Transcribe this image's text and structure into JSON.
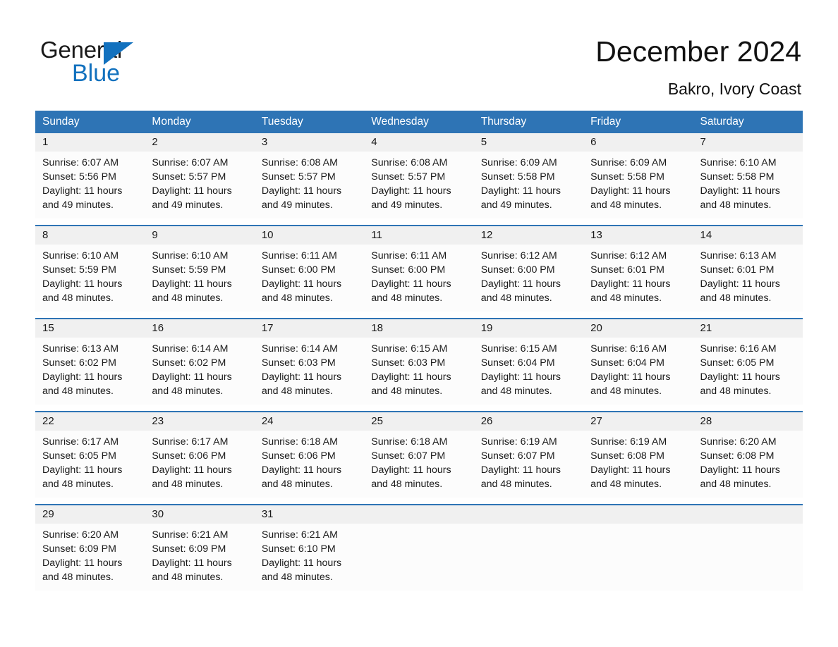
{
  "logo": {
    "word_one": "General",
    "word_two": "Blue",
    "triangle_color": "#1271BE",
    "text_color": "#1a1a1a"
  },
  "header": {
    "title": "December 2024",
    "location": "Bakro, Ivory Coast"
  },
  "theme": {
    "header_blue": "#2E74B5",
    "daynum_band": "#F0F0F0",
    "cell_background": "#FCFCFC",
    "text": "#1a1a1a"
  },
  "weekdays": [
    "Sunday",
    "Monday",
    "Tuesday",
    "Wednesday",
    "Thursday",
    "Friday",
    "Saturday"
  ],
  "weeks": [
    {
      "days": [
        {
          "num": "1",
          "sunrise": "Sunrise: 6:07 AM",
          "sunset": "Sunset: 5:56 PM",
          "daylight": "Daylight: 11 hours and 49 minutes."
        },
        {
          "num": "2",
          "sunrise": "Sunrise: 6:07 AM",
          "sunset": "Sunset: 5:57 PM",
          "daylight": "Daylight: 11 hours and 49 minutes."
        },
        {
          "num": "3",
          "sunrise": "Sunrise: 6:08 AM",
          "sunset": "Sunset: 5:57 PM",
          "daylight": "Daylight: 11 hours and 49 minutes."
        },
        {
          "num": "4",
          "sunrise": "Sunrise: 6:08 AM",
          "sunset": "Sunset: 5:57 PM",
          "daylight": "Daylight: 11 hours and 49 minutes."
        },
        {
          "num": "5",
          "sunrise": "Sunrise: 6:09 AM",
          "sunset": "Sunset: 5:58 PM",
          "daylight": "Daylight: 11 hours and 49 minutes."
        },
        {
          "num": "6",
          "sunrise": "Sunrise: 6:09 AM",
          "sunset": "Sunset: 5:58 PM",
          "daylight": "Daylight: 11 hours and 48 minutes."
        },
        {
          "num": "7",
          "sunrise": "Sunrise: 6:10 AM",
          "sunset": "Sunset: 5:58 PM",
          "daylight": "Daylight: 11 hours and 48 minutes."
        }
      ]
    },
    {
      "days": [
        {
          "num": "8",
          "sunrise": "Sunrise: 6:10 AM",
          "sunset": "Sunset: 5:59 PM",
          "daylight": "Daylight: 11 hours and 48 minutes."
        },
        {
          "num": "9",
          "sunrise": "Sunrise: 6:10 AM",
          "sunset": "Sunset: 5:59 PM",
          "daylight": "Daylight: 11 hours and 48 minutes."
        },
        {
          "num": "10",
          "sunrise": "Sunrise: 6:11 AM",
          "sunset": "Sunset: 6:00 PM",
          "daylight": "Daylight: 11 hours and 48 minutes."
        },
        {
          "num": "11",
          "sunrise": "Sunrise: 6:11 AM",
          "sunset": "Sunset: 6:00 PM",
          "daylight": "Daylight: 11 hours and 48 minutes."
        },
        {
          "num": "12",
          "sunrise": "Sunrise: 6:12 AM",
          "sunset": "Sunset: 6:00 PM",
          "daylight": "Daylight: 11 hours and 48 minutes."
        },
        {
          "num": "13",
          "sunrise": "Sunrise: 6:12 AM",
          "sunset": "Sunset: 6:01 PM",
          "daylight": "Daylight: 11 hours and 48 minutes."
        },
        {
          "num": "14",
          "sunrise": "Sunrise: 6:13 AM",
          "sunset": "Sunset: 6:01 PM",
          "daylight": "Daylight: 11 hours and 48 minutes."
        }
      ]
    },
    {
      "days": [
        {
          "num": "15",
          "sunrise": "Sunrise: 6:13 AM",
          "sunset": "Sunset: 6:02 PM",
          "daylight": "Daylight: 11 hours and 48 minutes."
        },
        {
          "num": "16",
          "sunrise": "Sunrise: 6:14 AM",
          "sunset": "Sunset: 6:02 PM",
          "daylight": "Daylight: 11 hours and 48 minutes."
        },
        {
          "num": "17",
          "sunrise": "Sunrise: 6:14 AM",
          "sunset": "Sunset: 6:03 PM",
          "daylight": "Daylight: 11 hours and 48 minutes."
        },
        {
          "num": "18",
          "sunrise": "Sunrise: 6:15 AM",
          "sunset": "Sunset: 6:03 PM",
          "daylight": "Daylight: 11 hours and 48 minutes."
        },
        {
          "num": "19",
          "sunrise": "Sunrise: 6:15 AM",
          "sunset": "Sunset: 6:04 PM",
          "daylight": "Daylight: 11 hours and 48 minutes."
        },
        {
          "num": "20",
          "sunrise": "Sunrise: 6:16 AM",
          "sunset": "Sunset: 6:04 PM",
          "daylight": "Daylight: 11 hours and 48 minutes."
        },
        {
          "num": "21",
          "sunrise": "Sunrise: 6:16 AM",
          "sunset": "Sunset: 6:05 PM",
          "daylight": "Daylight: 11 hours and 48 minutes."
        }
      ]
    },
    {
      "days": [
        {
          "num": "22",
          "sunrise": "Sunrise: 6:17 AM",
          "sunset": "Sunset: 6:05 PM",
          "daylight": "Daylight: 11 hours and 48 minutes."
        },
        {
          "num": "23",
          "sunrise": "Sunrise: 6:17 AM",
          "sunset": "Sunset: 6:06 PM",
          "daylight": "Daylight: 11 hours and 48 minutes."
        },
        {
          "num": "24",
          "sunrise": "Sunrise: 6:18 AM",
          "sunset": "Sunset: 6:06 PM",
          "daylight": "Daylight: 11 hours and 48 minutes."
        },
        {
          "num": "25",
          "sunrise": "Sunrise: 6:18 AM",
          "sunset": "Sunset: 6:07 PM",
          "daylight": "Daylight: 11 hours and 48 minutes."
        },
        {
          "num": "26",
          "sunrise": "Sunrise: 6:19 AM",
          "sunset": "Sunset: 6:07 PM",
          "daylight": "Daylight: 11 hours and 48 minutes."
        },
        {
          "num": "27",
          "sunrise": "Sunrise: 6:19 AM",
          "sunset": "Sunset: 6:08 PM",
          "daylight": "Daylight: 11 hours and 48 minutes."
        },
        {
          "num": "28",
          "sunrise": "Sunrise: 6:20 AM",
          "sunset": "Sunset: 6:08 PM",
          "daylight": "Daylight: 11 hours and 48 minutes."
        }
      ]
    },
    {
      "days": [
        {
          "num": "29",
          "sunrise": "Sunrise: 6:20 AM",
          "sunset": "Sunset: 6:09 PM",
          "daylight": "Daylight: 11 hours and 48 minutes."
        },
        {
          "num": "30",
          "sunrise": "Sunrise: 6:21 AM",
          "sunset": "Sunset: 6:09 PM",
          "daylight": "Daylight: 11 hours and 48 minutes."
        },
        {
          "num": "31",
          "sunrise": "Sunrise: 6:21 AM",
          "sunset": "Sunset: 6:10 PM",
          "daylight": "Daylight: 11 hours and 48 minutes."
        },
        {
          "num": "",
          "sunrise": "",
          "sunset": "",
          "daylight": ""
        },
        {
          "num": "",
          "sunrise": "",
          "sunset": "",
          "daylight": ""
        },
        {
          "num": "",
          "sunrise": "",
          "sunset": "",
          "daylight": ""
        },
        {
          "num": "",
          "sunrise": "",
          "sunset": "",
          "daylight": ""
        }
      ]
    }
  ]
}
